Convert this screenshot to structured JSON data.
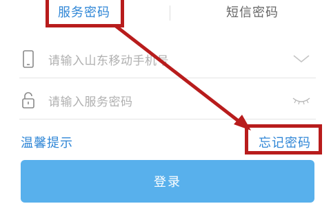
{
  "tabs": {
    "password_label": "服务密码",
    "sms_label": "短信密码"
  },
  "form": {
    "phone_placeholder": "请输入山东移动手机号",
    "password_placeholder": "请输入服务密码"
  },
  "links": {
    "tips_label": "温馨提示",
    "forgot_label": "忘记密码"
  },
  "login_button_label": "登录",
  "icons": {
    "phone": "mobile-phone-icon",
    "lock": "lock-icon",
    "dropdown": "chevron-down-icon",
    "eye": "eye-closed-icon"
  },
  "colors": {
    "accent": "#2f86d6",
    "button": "#58b0ec",
    "annotation": "#b81c1c"
  }
}
